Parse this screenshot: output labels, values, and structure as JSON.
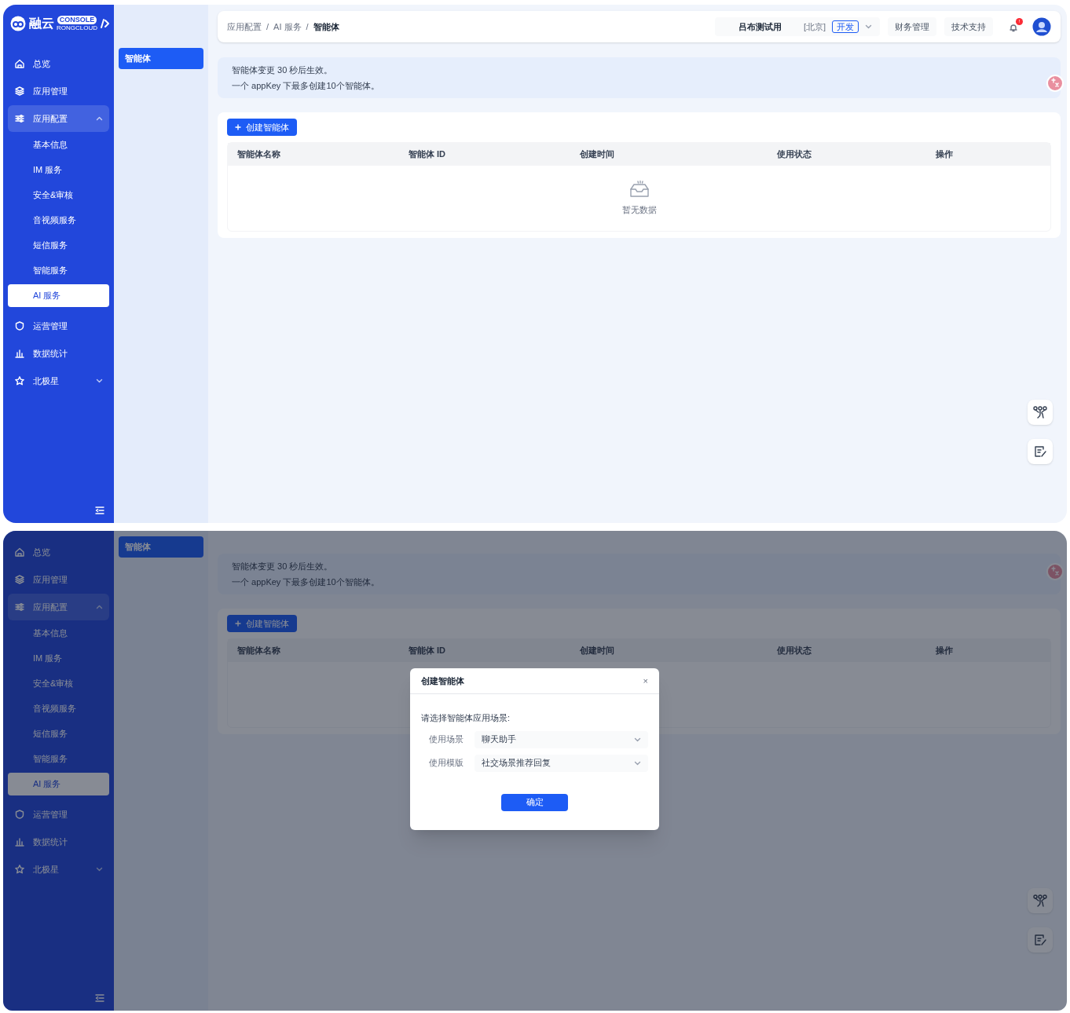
{
  "screens": [
    {
      "logo": {
        "name": "融云",
        "badge": "CONSOLE",
        "sub": "RONGCLOUD"
      },
      "sidebar": {
        "items": [
          {
            "label": "总览",
            "selected": false
          },
          {
            "label": "应用管理",
            "selected": false
          },
          {
            "label": "应用配置",
            "selected": true,
            "expanded": true,
            "children": [
              {
                "label": "基本信息",
                "selected": false
              },
              {
                "label": "IM 服务",
                "selected": false
              },
              {
                "label": "安全&审核",
                "selected": false
              },
              {
                "label": "音视频服务",
                "selected": false
              },
              {
                "label": "短信服务",
                "selected": false
              },
              {
                "label": "智能服务",
                "selected": false
              },
              {
                "label": "AI 服务",
                "selected": true
              }
            ]
          },
          {
            "label": "运营管理",
            "selected": false
          },
          {
            "label": "数据统计",
            "selected": false
          },
          {
            "label": "北极星",
            "selected": false,
            "expanded": false
          }
        ]
      },
      "subnav": [
        {
          "label": "智能体",
          "selected": true
        }
      ],
      "header": {
        "breadcrumb": {
          "items": [
            "应用配置",
            "AI 服务",
            "智能体"
          ],
          "separator": "/"
        },
        "account": {
          "name": "吕布测试用",
          "region": "[北京]",
          "env": "开发"
        },
        "buttons": [
          "财务管理",
          "技术支持"
        ],
        "notification_badge": "!"
      },
      "notice": [
        "智能体变更 30 秒后生效。",
        "一个 appKey 下最多创建10个智能体。"
      ],
      "create_button": "创建智能体",
      "table": {
        "columns": [
          "智能体名称",
          "智能体 ID",
          "创建时间",
          "使用状态",
          "操作"
        ],
        "empty_text": "暂无数据"
      }
    },
    {
      "sidebar": {
        "items": [
          {
            "label": "总览",
            "selected": false
          },
          {
            "label": "应用管理",
            "selected": false
          },
          {
            "label": "应用配置",
            "selected": true,
            "expanded": true,
            "children": [
              {
                "label": "基本信息",
                "selected": false
              },
              {
                "label": "IM 服务",
                "selected": false
              },
              {
                "label": "安全&审核",
                "selected": false
              },
              {
                "label": "音视频服务",
                "selected": false
              },
              {
                "label": "短信服务",
                "selected": false
              },
              {
                "label": "智能服务",
                "selected": false
              },
              {
                "label": "AI 服务",
                "selected": true
              }
            ]
          },
          {
            "label": "运营管理",
            "selected": false
          },
          {
            "label": "数据统计",
            "selected": false
          },
          {
            "label": "北极星",
            "selected": false,
            "expanded": false
          }
        ]
      },
      "subnav": [
        {
          "label": "智能体",
          "selected": true
        }
      ],
      "notice": [
        "智能体变更 30 秒后生效。",
        "一个 appKey 下最多创建10个智能体。"
      ],
      "create_button": "创建智能体",
      "table": {
        "columns": [
          "智能体名称",
          "智能体 ID",
          "创建时间",
          "使用状态",
          "操作"
        ]
      },
      "dialog": {
        "title": "创建智能体",
        "close": "×",
        "prompt": "请选择智能体应用场景:",
        "fields": [
          {
            "label": "使用场景",
            "value": "聊天助手"
          },
          {
            "label": "使用模版",
            "value": "社交场景推荐回复"
          }
        ],
        "confirm": "确定"
      }
    }
  ]
}
